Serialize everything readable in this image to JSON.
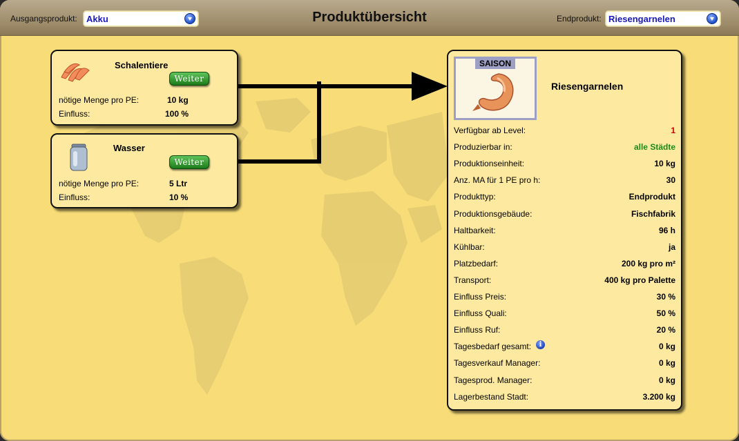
{
  "header": {
    "title": "Produktübersicht",
    "source_label": "Ausgangsprodukt:",
    "source_value": "Akku",
    "target_label": "Endprodukt:",
    "target_value": "Riesengarnelen"
  },
  "inputs": [
    {
      "name": "Schalentiere",
      "button": "Weiter",
      "amount_label": "nötige Menge pro PE:",
      "amount_value": "10 kg",
      "influence_label": "Einfluss:",
      "influence_value": "100 %"
    },
    {
      "name": "Wasser",
      "button": "Weiter",
      "amount_label": "nötige Menge pro PE:",
      "amount_value": "5 Ltr",
      "influence_label": "Einfluss:",
      "influence_value": "10 %"
    }
  ],
  "product": {
    "season_tag": "SAISON",
    "name": "Riesengarnelen",
    "rows": [
      {
        "k": "Verfügbar ab Level:",
        "v": "1",
        "color": "#cc0000"
      },
      {
        "k": "Produzierbar in:",
        "v": "alle Städte",
        "color": "#1a8a1a"
      },
      {
        "k": "Produktionseinheit:",
        "v": "10 kg"
      },
      {
        "k": "Anz. MA für 1 PE pro h:",
        "v": "30"
      },
      {
        "k": "Produkttyp:",
        "v": "Endprodukt"
      },
      {
        "k": "Produktionsgebäude:",
        "v": "Fischfabrik"
      },
      {
        "k": "Haltbarkeit:",
        "v": "96 h"
      },
      {
        "k": "Kühlbar:",
        "v": "ja"
      },
      {
        "k": "Platzbedarf:",
        "v": "200 kg pro m²"
      },
      {
        "k": "Transport:",
        "v": "400 kg pro Palette"
      },
      {
        "k": "Einfluss Preis:",
        "v": "30 %"
      },
      {
        "k": "Einfluss Quali:",
        "v": "50 %"
      },
      {
        "k": "Einfluss Ruf:",
        "v": "20 %"
      },
      {
        "k": "Tagesbedarf gesamt:",
        "v": "0 kg",
        "info": true
      },
      {
        "k": "Tagesverkauf Manager:",
        "v": "0 kg"
      },
      {
        "k": "Tagesprod. Manager:",
        "v": "0 kg"
      },
      {
        "k": "Lagerbestand Stadt:",
        "v": "3.200 kg"
      }
    ]
  },
  "colors": {
    "background": "#f7dc78",
    "card": "#fdeaa0",
    "button": "#2f9a2a",
    "level": "#cc0000",
    "cities": "#1a8a1a"
  }
}
